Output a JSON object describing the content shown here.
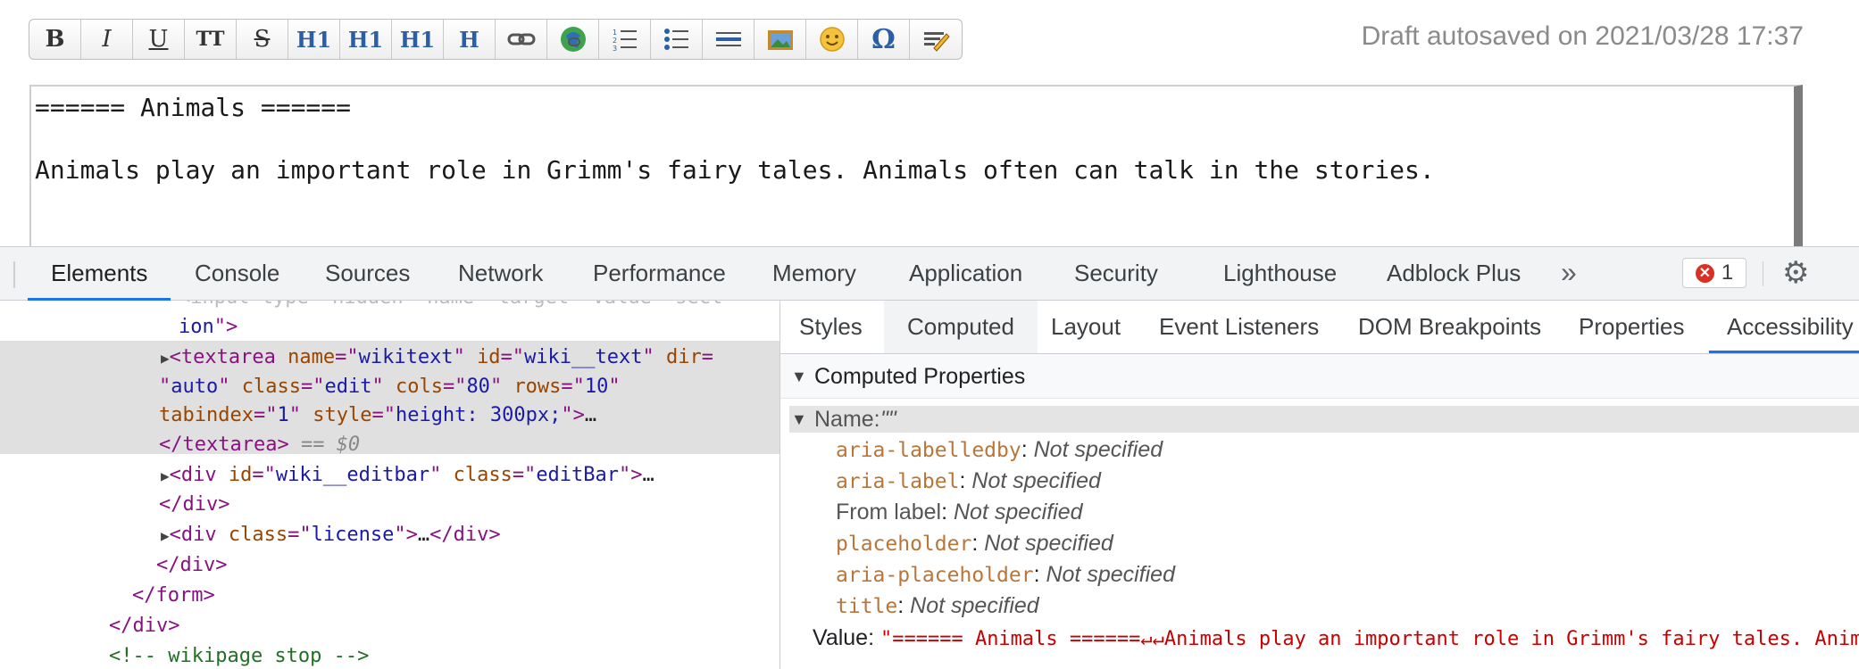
{
  "toolbar": {
    "buttons": [
      {
        "label": "B",
        "icon": "bold-icon"
      },
      {
        "label": "I",
        "icon": "italic-icon"
      },
      {
        "label": "U",
        "icon": "underline-icon"
      },
      {
        "label": "TT",
        "icon": "monospace-icon"
      },
      {
        "label": "S",
        "icon": "strikethrough-icon"
      },
      {
        "label": "H1",
        "icon": "heading-same-icon"
      },
      {
        "label": "H1",
        "icon": "heading-lower-icon"
      },
      {
        "label": "H1",
        "icon": "heading-higher-icon"
      },
      {
        "label": "H",
        "icon": "heading-menu-icon"
      },
      {
        "label": "",
        "icon": "link-icon"
      },
      {
        "label": "",
        "icon": "external-link-icon"
      },
      {
        "label": "",
        "icon": "ordered-list-icon"
      },
      {
        "label": "",
        "icon": "unordered-list-icon"
      },
      {
        "label": "",
        "icon": "horizontal-rule-icon"
      },
      {
        "label": "",
        "icon": "media-icon"
      },
      {
        "label": "",
        "icon": "smiley-icon"
      },
      {
        "label": "Ω",
        "icon": "special-chars-icon"
      },
      {
        "label": "",
        "icon": "signature-icon"
      }
    ]
  },
  "draft_status": "Draft autosaved on 2021/03/28 17:37",
  "editor": {
    "text": "====== Animals ======\n\nAnimals play an important role in Grimm's fairy tales. Animals often can talk in the stories."
  },
  "devtools": {
    "tabs": [
      "Elements",
      "Console",
      "Sources",
      "Network",
      "Performance",
      "Memory",
      "Application",
      "Security",
      "Lighthouse",
      "Adblock Plus"
    ],
    "active_tab": "Elements",
    "more_tabs": "»",
    "error_count": "1",
    "error_symbol": "✕",
    "settings_icon": "gear-icon",
    "menu_icon": "kebab-icon"
  },
  "tree": {
    "line0_faded": "<input type=\"hidden\" name=\"target\" value=\"sect",
    "line1": {
      "text": "ion",
      "close": "\">"
    },
    "textarea": {
      "tag": "textarea",
      "a1": "name",
      "v1": "wikitext",
      "a2": "id",
      "v2": "wiki__text",
      "a3": "dir",
      "v3": "auto",
      "a4": "class",
      "v4": "edit",
      "a5": "cols",
      "v5": "80",
      "a6": "rows",
      "v6": "10",
      "a7": "tabindex",
      "v7": "1",
      "a8": "style",
      "v8": "height: 300px;",
      "ellipsis": "…",
      "close": "</textarea>",
      "marker": "== $0"
    },
    "editbar": {
      "tag": "div",
      "a1": "id",
      "v1": "wiki__editbar",
      "a2": "class",
      "v2": "editBar",
      "ellipsis": "…",
      "close": "</div>"
    },
    "license": {
      "tag": "div",
      "a1": "class",
      "v1": "license",
      "ellipsis": "…",
      "close": "</div>"
    },
    "close_div": "</div>",
    "close_form": "</form>",
    "close_div2": "</div>",
    "comment": "<!-- wikipage stop -->"
  },
  "panel": {
    "tabs": [
      "Styles",
      "Computed",
      "Layout",
      "Event Listeners",
      "DOM Breakpoints",
      "Properties",
      "Accessibility"
    ],
    "active_tab": "Accessibility",
    "section_title": "Computed Properties",
    "name_label": "Name:",
    "name_value": "\"\"",
    "props": [
      {
        "key": "aria-labelledby",
        "mono": true,
        "value": "Not specified"
      },
      {
        "key": "aria-label",
        "mono": true,
        "value": "Not specified"
      },
      {
        "key": "From label",
        "mono": false,
        "value": "Not specified"
      },
      {
        "key": "placeholder",
        "mono": true,
        "value": "Not specified"
      },
      {
        "key": "aria-placeholder",
        "mono": true,
        "value": "Not specified"
      },
      {
        "key": "title",
        "mono": true,
        "value": "Not specified"
      }
    ],
    "value_label": "Value:",
    "value_text": "\"====== Animals ======↵↵Animals play an important role in Grimm's fairy tales. Animals often can talk in the stories.\""
  }
}
